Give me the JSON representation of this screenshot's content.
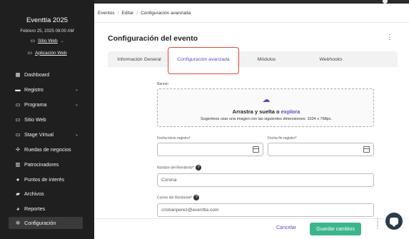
{
  "sidebar": {
    "event_title": "Eventtia 2025",
    "event_date": "Febrero 25, 2025 08:00 AM",
    "site_link": "Sitio Web",
    "app_link": "Aplicación Web",
    "items": [
      {
        "label": "Dashboard",
        "icon": "dashboard-icon",
        "glyph": "▦"
      },
      {
        "label": "Registro",
        "icon": "id-card-icon",
        "glyph": "▬",
        "chevron": "⌄"
      },
      {
        "label": "Programa",
        "icon": "calendar-icon",
        "glyph": "▭",
        "chevron": "⌄"
      },
      {
        "label": "Sitio Web",
        "icon": "browser-icon",
        "glyph": "▭"
      },
      {
        "label": "Stage Virtual",
        "icon": "screen-icon",
        "glyph": "▭",
        "chevron": "⌄"
      },
      {
        "label": "Ruedas de negocios",
        "icon": "handshake-icon",
        "glyph": "✢"
      },
      {
        "label": "Patrocinadores",
        "icon": "building-icon",
        "glyph": "▥"
      },
      {
        "label": "Puntos de interés",
        "icon": "map-pin-icon",
        "glyph": "●"
      },
      {
        "label": "Archivos",
        "icon": "folder-icon",
        "glyph": "▰"
      },
      {
        "label": "Reportes",
        "icon": "pie-chart-icon",
        "glyph": "◕"
      },
      {
        "label": "Configuración",
        "icon": "gear-icon",
        "glyph": "✲",
        "active": true
      }
    ]
  },
  "breadcrumb": [
    "Eventos",
    "Editar",
    "Configuración avanzada"
  ],
  "page_title": "Configuración del evento",
  "tabs": [
    {
      "label": "Información General"
    },
    {
      "label": "Configuración avanzada",
      "active": true
    },
    {
      "label": "Módulos"
    },
    {
      "label": "Webhooks"
    }
  ],
  "form": {
    "banner_label": "Banner",
    "dropzone_text": "Arrastra y suelta o",
    "dropzone_link": "explora",
    "dropzone_hint": "Sugerimos usar una imagen con las siguientes dimensiones: 1024 x 768px.",
    "start_date_label": "Fecha inicio registro*",
    "end_date_label": "Fecha fin registro*",
    "sender_name_label": "Nombre del Remitente*",
    "sender_name_value": "Corona",
    "sender_email_label": "Correo del Remitente*",
    "sender_email_value": "cristianperez@eventtia.com"
  },
  "footer": {
    "cancel": "Cancelar",
    "save": "Guardar cambios"
  },
  "colors": {
    "accent": "#5b4bc4",
    "save_button": "#3cb58c",
    "highlight": "#e0473f",
    "sidebar_bg": "#1f1f1f"
  }
}
